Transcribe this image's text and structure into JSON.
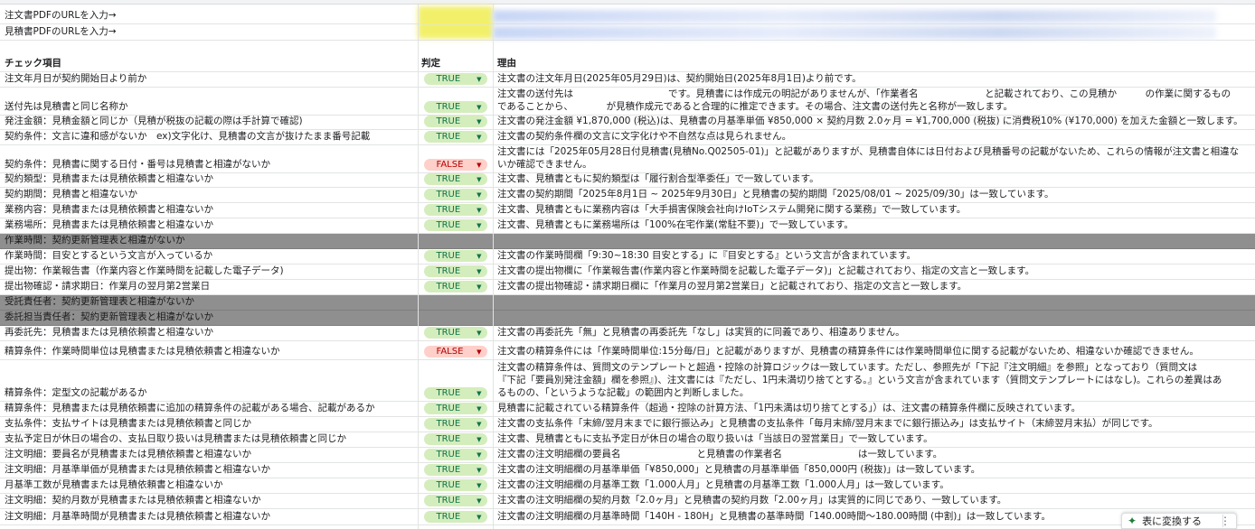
{
  "input_rows": [
    {
      "label": "注文書PDFのURLを入力→"
    },
    {
      "label": "見積書PDFのURLを入力→"
    }
  ],
  "header": {
    "item": "チェック項目",
    "judge": "判定",
    "reason": "理由"
  },
  "badge_colors": {
    "true_bg": "#d4edbc",
    "true_fg": "#11734b",
    "false_bg": "#ffcfc9",
    "false_fg": "#b10202",
    "section_gray": "#8f8f8f"
  },
  "rows": [
    {
      "item": "注文年月日が契約開始日より前か",
      "judge": "TRUE",
      "reason": [
        "注文書の注文年月日(2025年05月29日)は、契約開始日(2025年8月1日)より前です。"
      ]
    },
    {
      "item": "送付先は見積書と同じ名称か",
      "judge": "TRUE",
      "reason": [
        "注文書の送付先は　　　　　　　　　　です。見積書には作成元の明記がありませんが、「作業者名　　　　　　　と記載されており、この見積か　　　の作業に関するもの",
        "であることから、　　　　が見積作成元であると合理的に推定できます。その場合、注文書の送付先と名称が一致します。"
      ]
    },
    {
      "item": "発注金額：見積金額と同じか（見積が税抜の記載の際は手計算で確認)",
      "judge": "TRUE",
      "reason": [
        "注文書の発注金額 ¥1,870,000 (税込)は、見積書の月基準単価 ¥850,000 × 契約月数 2.0ヶ月 = ¥1,700,000 (税抜) に消費税10% (¥170,000) を加えた金額と一致します。"
      ]
    },
    {
      "item": "契約条件：文言に違和感がないか　ex)文字化け、見積書の文言が抜けたまま番号記載",
      "judge": "TRUE",
      "reason": [
        "注文書の契約条件欄の文言に文字化けや不自然な点は見られません。"
      ]
    },
    {
      "item": "契約条件：見積書に関する日付・番号は見積書と相違がないか",
      "judge": "FALSE",
      "reason": [
        "注文書には「2025年05月28日付見積書(見積No.Q02505-01)」と記載がありますが、見積書自体には日付および見積番号の記載がないため、これらの情報が注文書と相違な",
        "いか確認できません。"
      ]
    },
    {
      "item": "契約類型：見積書または見積依頼書と相違ないか",
      "judge": "TRUE",
      "reason": [
        "注文書、見積書ともに契約類型は「履行割合型準委任」で一致しています。"
      ]
    },
    {
      "item": "契約期間：見積書と相違ないか",
      "judge": "TRUE",
      "reason": [
        "注文書の契約期間「2025年8月1日 ~ 2025年9月30日」と見積書の契約期間「2025/08/01 ~ 2025/09/30」は一致しています。"
      ]
    },
    {
      "item": "業務内容：見積書または見積依頼書と相違ないか",
      "judge": "TRUE",
      "reason": [
        "注文書、見積書ともに業務内容は「大手損害保険会社向けIoTシステム開発に関する業務」で一致しています。"
      ]
    },
    {
      "item": "業務場所：見積書または見積依頼書と相違ないか",
      "judge": "TRUE",
      "reason": [
        "注文書、見積書ともに業務場所は「100%在宅作業(常駐不要)」で一致しています。"
      ]
    },
    {
      "item": "作業時間：契約更新管理表と相違がないか",
      "judge": "",
      "reason": [],
      "section": true
    },
    {
      "item": "作業時間：目安とするという文言が入っているか",
      "judge": "TRUE",
      "reason": [
        "注文書の作業時間欄「9:30~18:30 目安とする」に『目安とする』という文言が含まれています。"
      ]
    },
    {
      "item": "提出物：作業報告書（作業内容と作業時間を記載した電子データ)",
      "judge": "TRUE",
      "reason": [
        "注文書の提出物欄に「作業報告書(作業内容と作業時間を記載した電子データ)」と記載されており、指定の文言と一致します。"
      ]
    },
    {
      "item": "提出物確認・請求期日：作業月の翌月第2営業日",
      "judge": "TRUE",
      "reason": [
        "注文書の提出物確認・請求期日欄に「作業月の翌月第2営業日」と記載されており、指定の文言と一致します。"
      ]
    },
    {
      "item": "受託責任者：契約更新管理表と相違がないか",
      "judge": "",
      "reason": [],
      "section": true
    },
    {
      "item": "委託担当責任者：契約更新管理表と相違がないか",
      "judge": "",
      "reason": [],
      "section": true
    },
    {
      "item": "再委託先：見積書または見積依頼書と相違ないか",
      "judge": "TRUE",
      "reason": [
        "注文書の再委託先「無」と見積書の再委託先「なし」は実質的に同義であり、相違ありません。"
      ]
    },
    {
      "item": "精算条件：作業時間単位は見積書または見積依頼書と相違ないか",
      "judge": "FALSE",
      "reason": [
        "注文書の精算条件には「作業時間単位:15分毎/日」と記載がありますが、見積書の精算条件には作業時間単位に関する記載がないため、相違ないか確認できません。"
      ]
    },
    {
      "item": "精算条件：定型文の記載があるか",
      "judge": "TRUE",
      "reason": [
        "注文書の精算条件は、質問文のテンプレートと超過・控除の計算ロジックは一致しています。ただし、参照先が「下記『注文明細』を参照」となっており（質問文は",
        "『下記「要員別発注金額」欄を参照』)、注文書には『ただし、1円未満切り捨てとする。』という文言が含まれています（質問文テンプレートにはなし)。これらの差異はあ",
        "るものの、「というような記載」の範囲内と判断しました。"
      ]
    },
    {
      "item": "精算条件：見積書または見積依頼書に追加の精算条件の記載がある場合、記載があるか",
      "judge": "TRUE",
      "reason": [
        "見積書に記載されている精算条件（超過・控除の計算方法、「1円未満は切り捨てとする」）は、注文書の精算条件欄に反映されています。"
      ]
    },
    {
      "item": "支払条件：支払サイトは見積書または見積依頼書と同じか",
      "judge": "TRUE",
      "reason": [
        "注文書の支払条件「末締/翌月末までに銀行振込み」と見積書の支払条件「毎月末締/翌月末までに銀行振込み」は支払サイト（末締翌月末払）が同じです。"
      ]
    },
    {
      "item": "支払予定日が休日の場合の、支払日取り扱いは見積書または見積依頼書と同じか",
      "judge": "TRUE",
      "reason": [
        "注文書、見積書ともに支払予定日が休日の場合の取り扱いは「当該日の翌営業日」で一致しています。"
      ]
    },
    {
      "item": "注文明細：要員名が見積書または見積依頼書と相違ないか",
      "judge": "TRUE",
      "reason": [
        "注文書の注文明細欄の要員名　　　　　　　　と見積書の作業者名　　　　　　　　は一致しています。"
      ]
    },
    {
      "item": "注文明細：月基準単価が見積書または見積依頼書と相違ないか",
      "judge": "TRUE",
      "reason": [
        "注文書の注文明細欄の月基準単価「¥850,000」と見積書の月基準単価「850,000円 (税抜)」は一致しています。"
      ]
    },
    {
      "item": "月基準工数が見積書または見積依頼書と相違ないか",
      "judge": "TRUE",
      "reason": [
        "注文書の注文明細欄の月基準工数「1.000人月」と見積書の月基準工数「1.000人月」は一致しています。"
      ]
    },
    {
      "item": "注文明細：契約月数が見積書または見積依頼書と相違ないか",
      "judge": "TRUE",
      "reason": [
        "注文書の注文明細欄の契約月数「2.0ヶ月」と見積書の契約月数「2.00ヶ月」は実質的に同じであり、一致しています。"
      ]
    },
    {
      "item": "注文明細：月基準時間が見積書または見積依頼書と相違ないか",
      "judge": "TRUE",
      "reason": [
        "注文書の注文明細欄の月基準時間「140H - 180H」と見積書の基準時間「140.00時間～180.00時間 (中割)」は一致しています。"
      ]
    }
  ],
  "footer_button": {
    "label": "表に変換する",
    "more": "⋮"
  }
}
